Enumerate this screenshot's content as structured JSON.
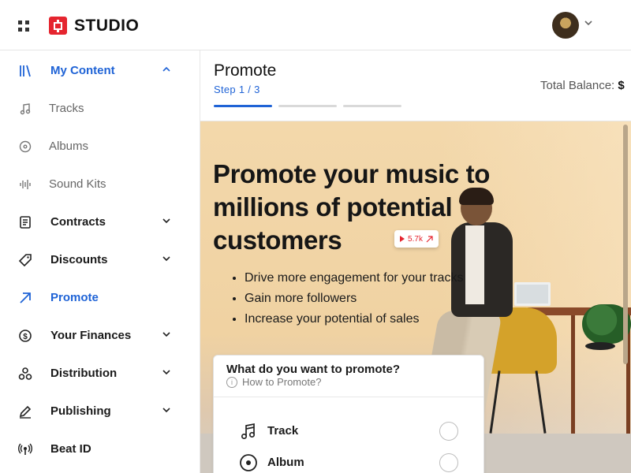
{
  "app": {
    "brand": "STUDIO",
    "brand_color": "#e5252f",
    "accent_color": "#1f63d6"
  },
  "header": {
    "apps_icon": "grid-icon",
    "avatar_icon": "user-avatar",
    "chevron_icon": "chevron-down-icon"
  },
  "sidebar": {
    "items": [
      {
        "label": "My Content",
        "icon": "library-icon",
        "expanded": true,
        "active": true
      },
      {
        "label": "Tracks",
        "icon": "music-note-icon",
        "sub": true
      },
      {
        "label": "Albums",
        "icon": "disc-icon",
        "sub": true
      },
      {
        "label": "Sound Kits",
        "icon": "waveform-icon",
        "sub": true
      },
      {
        "label": "Contracts",
        "icon": "document-icon",
        "chevron": "down"
      },
      {
        "label": "Discounts",
        "icon": "tag-icon",
        "chevron": "down"
      },
      {
        "label": "Promote",
        "icon": "arrow-up-right-icon",
        "active": true
      },
      {
        "label": "Your Finances",
        "icon": "dollar-icon",
        "chevron": "down"
      },
      {
        "label": "Distribution",
        "icon": "distribution-icon",
        "chevron": "down"
      },
      {
        "label": "Publishing",
        "icon": "pen-icon",
        "chevron": "down"
      },
      {
        "label": "Beat ID",
        "icon": "broadcast-icon"
      }
    ]
  },
  "main": {
    "title": "Promote",
    "step": "Step 1 / 3",
    "progress_steps": 3,
    "progress_current": 1,
    "balance_label": "Total Balance:",
    "balance_value": "$"
  },
  "hero": {
    "headline": "Promote your music to millions of potential customers",
    "bullets": [
      "Drive more engagement for your tracks",
      "Gain more followers",
      "Increase your potential of sales"
    ],
    "views_badge": "5.7k"
  },
  "promote_card": {
    "title": "What do you want to promote?",
    "help": "How to Promote?",
    "options": [
      {
        "label": "Track",
        "icon": "music-note-icon",
        "selected": false
      },
      {
        "label": "Album",
        "icon": "disc-icon",
        "selected": false
      }
    ]
  }
}
